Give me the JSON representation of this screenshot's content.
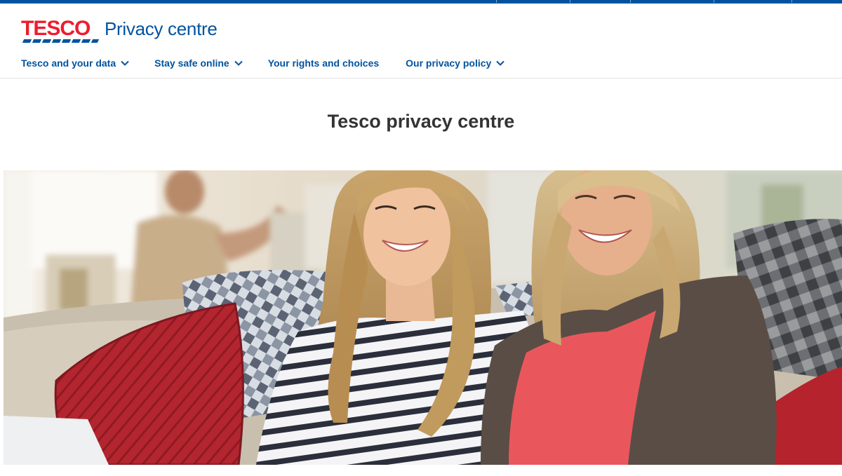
{
  "brand": {
    "logo_text": "TESCO",
    "product_name": "Privacy centre",
    "colors": {
      "brand_red": "#ee1c2e",
      "brand_blue": "#00539f",
      "title_text": "#333333"
    }
  },
  "nav": {
    "items": [
      {
        "label": "Tesco and your data",
        "has_dropdown": true,
        "icon": "chevron-down-icon"
      },
      {
        "label": "Stay safe online",
        "has_dropdown": true,
        "icon": "chevron-down-icon"
      },
      {
        "label": "Your rights and choices",
        "has_dropdown": false
      },
      {
        "label": "Our privacy policy",
        "has_dropdown": true,
        "icon": "chevron-down-icon"
      }
    ]
  },
  "main": {
    "title": "Tesco privacy centre"
  }
}
